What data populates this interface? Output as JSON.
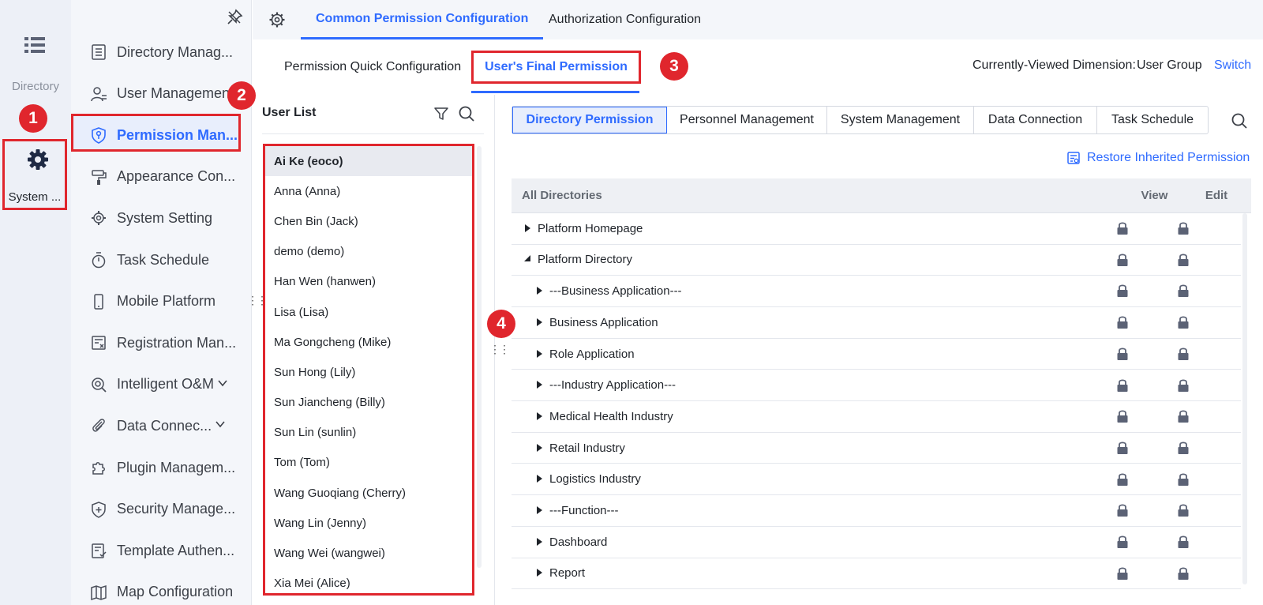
{
  "rail": {
    "directory_label": "Directory",
    "system_label": "System ..."
  },
  "sidebar": {
    "items": [
      {
        "label": "Directory Manag...",
        "icon": "list-doc-icon"
      },
      {
        "label": "User Management",
        "icon": "user-list-icon"
      },
      {
        "label": "Permission Man...",
        "icon": "shield-key-icon",
        "active": true
      },
      {
        "label": "Appearance Con...",
        "icon": "paint-roller-icon"
      },
      {
        "label": "System Setting",
        "icon": "gear-icon"
      },
      {
        "label": "Task Schedule",
        "icon": "stopwatch-icon"
      },
      {
        "label": "Mobile Platform",
        "icon": "mobile-icon"
      },
      {
        "label": "Registration Man...",
        "icon": "registration-icon"
      },
      {
        "label": "Intelligent O&M",
        "icon": "om-icon",
        "expandable": true
      },
      {
        "label": "Data Connec...",
        "icon": "paperclip-icon",
        "expandable": true
      },
      {
        "label": "Plugin Managem...",
        "icon": "puzzle-icon"
      },
      {
        "label": "Security Manage...",
        "icon": "shield-plus-icon"
      },
      {
        "label": "Template Authen...",
        "icon": "template-icon"
      },
      {
        "label": "Map Configuration",
        "icon": "map-icon"
      }
    ]
  },
  "top_tabs": {
    "common": "Common Permission Configuration",
    "authorization": "Authorization Configuration"
  },
  "sub_tabs": {
    "quick": "Permission Quick Configuration",
    "final": "User's Final Permission"
  },
  "dimension": {
    "label": "Currently-Viewed Dimension:",
    "value": "User Group",
    "switch": "Switch"
  },
  "badges": [
    "1",
    "2",
    "3",
    "4"
  ],
  "user_list": {
    "title": "User List",
    "users": [
      "Ai Ke (eoco)",
      "Anna (Anna)",
      "Chen Bin (Jack)",
      "demo (demo)",
      "Han Wen (hanwen)",
      "Lisa (Lisa)",
      "Ma Gongcheng (Mike)",
      "Sun Hong (Lily)",
      "Sun Jiancheng (Billy)",
      "Sun Lin (sunlin)",
      "Tom (Tom)",
      "Wang Guoqiang (Cherry)",
      "Wang Lin (Jenny)",
      "Wang Wei (wangwei)",
      "Xia Mei (Alice)"
    ]
  },
  "perm_tabs": [
    "Directory Permission",
    "Personnel Management",
    "System Management",
    "Data Connection",
    "Task Schedule"
  ],
  "restore_label": "Restore Inherited Permission",
  "table": {
    "headers": {
      "name": "All Directories",
      "view": "View",
      "edit": "Edit"
    },
    "rows": [
      {
        "label": "Platform Homepage",
        "level": 0,
        "expanded": false
      },
      {
        "label": "Platform Directory",
        "level": 0,
        "expanded": true
      },
      {
        "label": "---Business Application---",
        "level": 1,
        "expanded": false
      },
      {
        "label": "Business Application",
        "level": 1,
        "expanded": false
      },
      {
        "label": "Role Application",
        "level": 1,
        "expanded": false
      },
      {
        "label": "---Industry Application---",
        "level": 1,
        "expanded": false
      },
      {
        "label": "Medical Health Industry",
        "level": 1,
        "expanded": false
      },
      {
        "label": "Retail Industry",
        "level": 1,
        "expanded": false
      },
      {
        "label": "Logistics Industry",
        "level": 1,
        "expanded": false
      },
      {
        "label": "---Function---",
        "level": 1,
        "expanded": false
      },
      {
        "label": "Dashboard",
        "level": 1,
        "expanded": false
      },
      {
        "label": "Report",
        "level": 1,
        "expanded": false
      }
    ]
  },
  "colors": {
    "accent": "#2f6bff",
    "highlight": "#e0262d"
  }
}
